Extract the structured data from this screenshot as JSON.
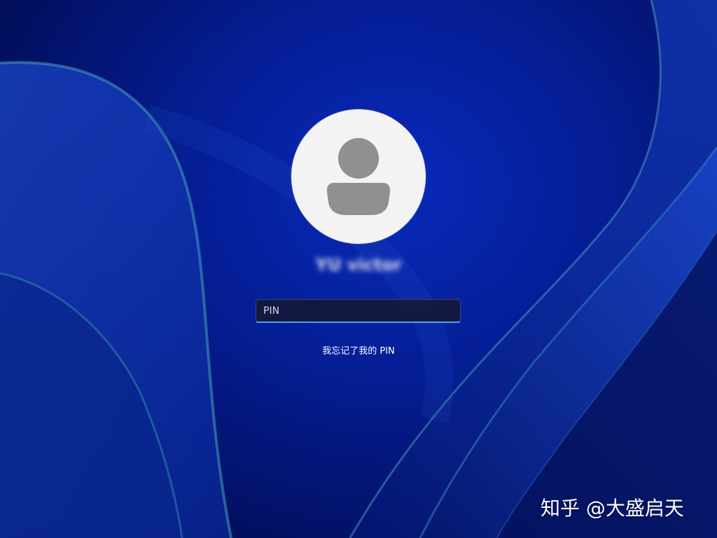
{
  "lock_screen": {
    "username": "YU victor",
    "pin_placeholder": "PIN",
    "pin_value": "",
    "forgot_pin_link": "我忘记了我的 PIN"
  },
  "watermark": {
    "text": "知乎 @大盛启天"
  },
  "colors": {
    "wallpaper_primary": "#0622a8",
    "wallpaper_dark": "#020a40",
    "input_focus_underline": "#4fa3f7",
    "avatar_background": "#f3f3f3",
    "avatar_glyph": "#909090"
  },
  "icons": {
    "avatar": "default-user-icon"
  }
}
